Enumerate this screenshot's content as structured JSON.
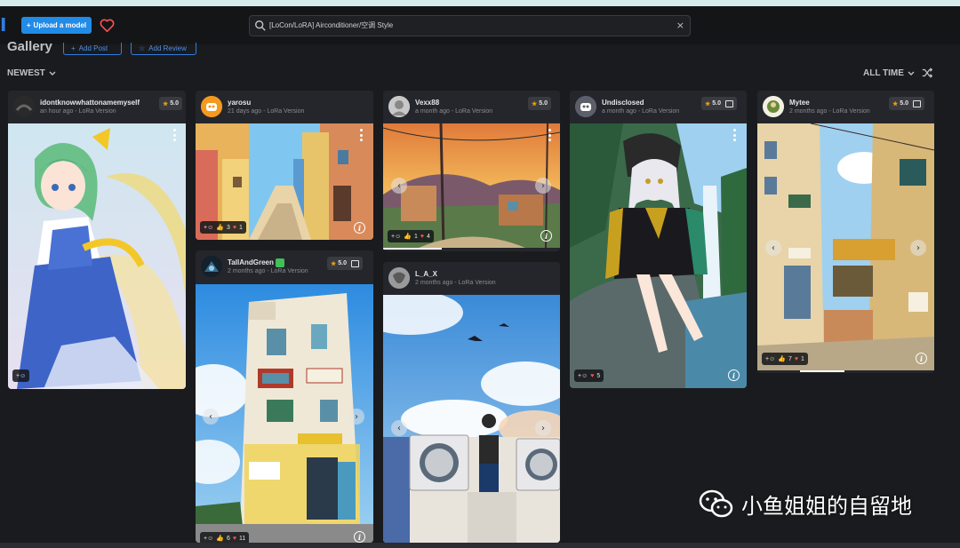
{
  "header": {
    "logo": "I",
    "upload_label": "Upload a model",
    "search_value": "[LoCon/LoRA] Airconditioner/空调 Style",
    "clear_glyph": "×"
  },
  "gallery": {
    "title": "Gallery",
    "add_post": "Add Post",
    "add_review": "Add Review",
    "sort": "NEWEST",
    "period": "ALL TIME"
  },
  "cards": [
    {
      "user": "idontknowwhattonamemyself",
      "meta": "an hour ago - LoRa Version",
      "rating": "5.0",
      "reactions": {
        "likes": "",
        "hearts": ""
      }
    },
    {
      "user": "yarosu",
      "meta": "21 days ago - LoRa Version",
      "rating": "",
      "reactions": {
        "likes": "3",
        "hearts": "1"
      }
    },
    {
      "user": "TallAndGreen",
      "meta": "2 months ago - LoRa Version",
      "rating": "5.0",
      "reactions": {
        "likes": "6",
        "hearts": "11"
      }
    },
    {
      "user": "Vexx88",
      "meta": "a month ago - LoRa Version",
      "rating": "5.0",
      "reactions": {
        "likes": "1",
        "hearts": "4"
      }
    },
    {
      "user": "L_A_X",
      "meta": "2 months ago - LoRa Version",
      "rating": "",
      "reactions": {
        "likes": "",
        "hearts": ""
      }
    },
    {
      "user": "Undisclosed",
      "meta": "a month ago - LoRa Version",
      "rating": "5.0",
      "reactions": {
        "likes": "",
        "hearts": "5"
      }
    },
    {
      "user": "Mytee",
      "meta": "2 months ago - LoRa Version",
      "rating": "5.0",
      "reactions": {
        "likes": "7",
        "hearts": "1"
      }
    }
  ],
  "watermark": "小鱼姐姐的自留地",
  "colors": {
    "accent": "#228be6",
    "background": "#1a1b1e",
    "card": "#25262b",
    "star": "#f59f00",
    "heart": "#fa5252"
  }
}
